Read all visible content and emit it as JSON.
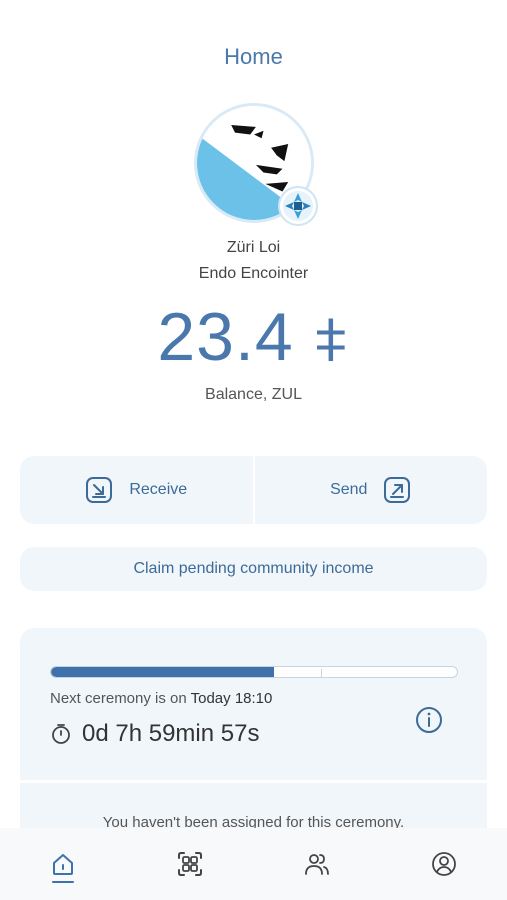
{
  "header": {
    "title": "Home"
  },
  "profile": {
    "community_name": "Züri Loi",
    "role": "Endo Encointer"
  },
  "balance": {
    "amount": "23.4",
    "currency_symbol": "⧧",
    "label": "Balance, ZUL"
  },
  "actions": {
    "receive_label": "Receive",
    "send_label": "Send",
    "claim_label": "Claim pending community income"
  },
  "ceremony": {
    "progress": 0.55,
    "next_prefix": "Next ceremony is on ",
    "next_time": "Today 18:10",
    "countdown": "0d 7h 59min 57s",
    "assignment_text": "You haven't been assigned for this ceremony."
  },
  "tabs": [
    {
      "name": "home",
      "icon": "home-icon",
      "active": true
    },
    {
      "name": "scan",
      "icon": "qr-scan-icon",
      "active": false
    },
    {
      "name": "contacts",
      "icon": "contacts-icon",
      "active": false
    },
    {
      "name": "profile",
      "icon": "profile-icon",
      "active": false
    }
  ],
  "colors": {
    "accent": "#4a78ad",
    "card_bg": "#f1f6fa",
    "progress_fill": "#3f72ad",
    "avatar_blue": "#6cc1e8"
  }
}
